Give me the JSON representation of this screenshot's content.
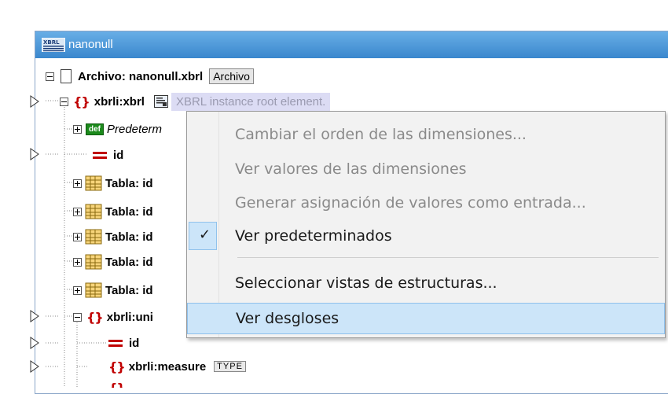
{
  "window": {
    "title": "nanonull"
  },
  "tree": {
    "file_label": "Archivo: nanonull.xbrl",
    "file_button": "Archivo",
    "root_label": "xbrli:xbrl",
    "root_annotation": "XBRL instance root element.",
    "def_badge": "def",
    "def_label": "Predeterm",
    "id_label": "id",
    "tables": [
      "Tabla: id",
      "Tabla: id",
      "Tabla: id",
      "Tabla: id",
      "Tabla: id"
    ],
    "unit_label": "xbrli:uni",
    "unit_id_label": "id",
    "measure_label": "xbrli:measure",
    "measure_type": "TYPE"
  },
  "context_menu": {
    "items": [
      {
        "label": "Cambiar el orden de las dimensiones...",
        "enabled": false
      },
      {
        "label": "Ver valores de las dimensiones",
        "enabled": false
      },
      {
        "label": "Generar asignación de valores como entrada...",
        "enabled": false
      },
      {
        "label": "Ver predeterminados",
        "enabled": true,
        "checked": true
      },
      {
        "label": "Seleccionar vistas de estructuras...",
        "enabled": true
      },
      {
        "label": "Ver desgloses",
        "enabled": true,
        "hovered": true
      }
    ]
  },
  "colors": {
    "title_bar": "#3a87cd",
    "element_icon": "#c00000",
    "menu_hover": "#cce5f9"
  }
}
